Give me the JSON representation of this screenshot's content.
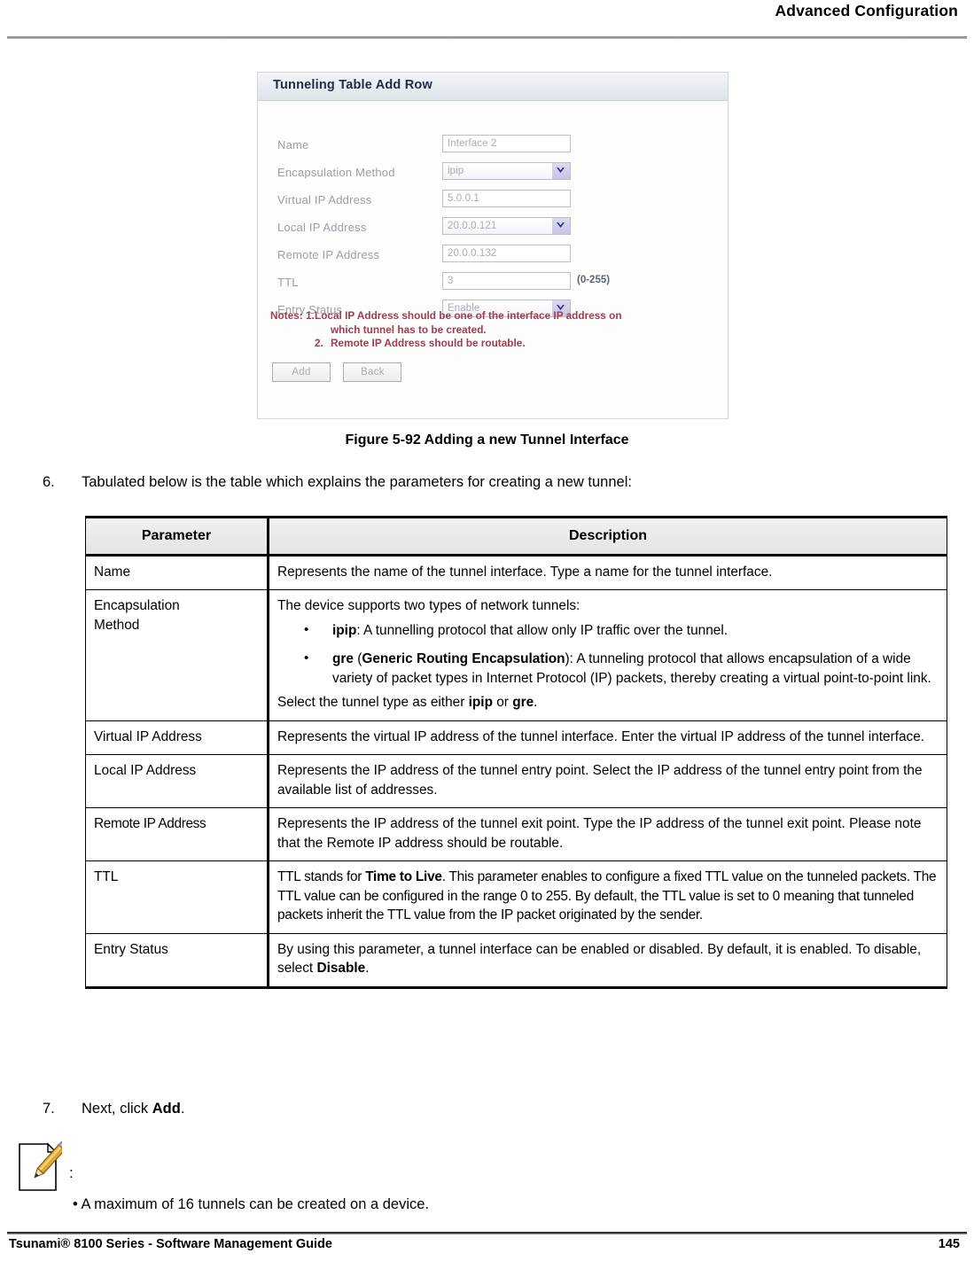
{
  "header": {
    "title": "Advanced Configuration"
  },
  "figure": {
    "panel_title": "Tunneling Table Add Row",
    "fields": [
      {
        "label": "Name",
        "value": "Interface 2",
        "type": "text",
        "hint": ""
      },
      {
        "label": "Encapsulation Method",
        "value": "ipip",
        "type": "select",
        "hint": ""
      },
      {
        "label": "Virtual IP Address",
        "value": "5.0.0.1",
        "type": "text",
        "hint": ""
      },
      {
        "label": "Local IP Address",
        "value": "20.0.0.121",
        "type": "select",
        "hint": ""
      },
      {
        "label": "Remote IP Address",
        "value": "20.0.0.132",
        "type": "text",
        "hint": ""
      },
      {
        "label": "TTL",
        "value": "3",
        "type": "text",
        "hint": "(0-255)"
      },
      {
        "label": "Entry Status",
        "value": "Enable",
        "type": "select",
        "hint": ""
      }
    ],
    "notes_lead": "Notes: 1.",
    "notes_1": "Local IP Address should be one of the interface IP address on",
    "notes_1b": "which tunnel has to be created.",
    "notes_2_lead": "2.",
    "notes_2": "Remote IP Address should be routable.",
    "buttons": {
      "add": "Add",
      "back": "Back"
    },
    "caption": "Figure 5-92 Adding a new Tunnel Interface"
  },
  "steps": {
    "six_num": "6.",
    "six_text": "Tabulated below is the table which explains the parameters for creating a new tunnel:",
    "seven_num": "7.",
    "seven_text_a": "Next, click ",
    "seven_bold": "Add",
    "seven_text_b": "."
  },
  "table": {
    "headers": {
      "parameter": "Parameter",
      "description": "Description"
    },
    "rows": [
      {
        "parameter": "Name",
        "description": "Represents the name of the tunnel interface. Type a name for the tunnel interface."
      },
      {
        "parameter_line1": "Encapsulation",
        "parameter_line2": "Method",
        "intro": "The device supports two types of network tunnels:",
        "bullet1_bold": "ipip",
        "bullet1_rest": ": A tunnelling protocol that allow only IP traffic over the tunnel.",
        "bullet2_bold": "gre",
        "bullet2_paren_open": " (",
        "bullet2_bold2": "Generic Routing Encapsulation",
        "bullet2_rest": "): A tunneling protocol that allows encapsulation of a wide variety of packet types in Internet Protocol (IP) packets, thereby creating a virtual point-to-point link.",
        "outro_a": "Select the tunnel type as either ",
        "outro_bold1": "ipip",
        "outro_b": " or ",
        "outro_bold2": "gre",
        "outro_c": "."
      },
      {
        "parameter": "Virtual IP Address",
        "description": "Represents the virtual IP address of the tunnel interface. Enter the virtual IP address of the tunnel interface."
      },
      {
        "parameter": "Local IP Address",
        "description": "Represents the IP address of the tunnel entry point. Select the IP address of the tunnel entry point from the available list of addresses."
      },
      {
        "parameter": "Remote IP Address",
        "description": "Represents the IP address of the tunnel exit point. Type the IP address of the tunnel exit point. Please note that the Remote IP address should be routable."
      },
      {
        "parameter": "TTL",
        "description_a": "TTL stands for ",
        "description_bold": "Time to Live",
        "description_b": ". This parameter enables to configure a fixed TTL value on the tunneled packets. The TTL value can be configured in the range 0 to 255. By default, the TTL value is set to 0 meaning that tunneled packets inherit the TTL value from the IP packet originated by the sender."
      },
      {
        "parameter": "Entry Status",
        "description_a": "By using this parameter, a tunnel interface can be enabled or disabled. By default, it is enabled. To disable, select ",
        "description_bold": "Disable",
        "description_b": "."
      }
    ]
  },
  "note": {
    "colon": ":",
    "bullet": "• A maximum of 16 tunnels can be created on a device."
  },
  "footer": {
    "left": "Tsunami® 8100 Series - Software Management Guide",
    "page": "145"
  }
}
